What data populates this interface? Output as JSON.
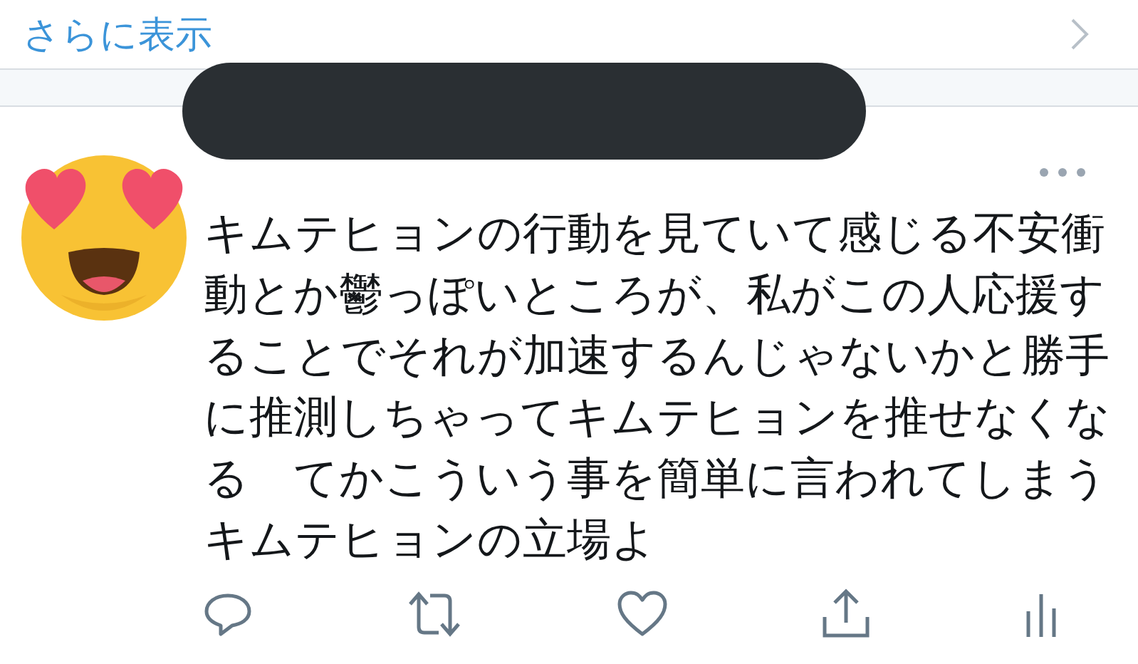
{
  "show_more": {
    "label": "さらに表示"
  },
  "tweet": {
    "text": "キムテヒョンの行動を見ていて感じる不安衝動とか鬱っぽいところが、私がこの人応援することでそれが加速するんじゃないかと勝手に推測しちゃってキムテヒョンを推せなくなる　てかこういう事を簡単に言われてしまうキムテヒョンの立場よ"
  }
}
